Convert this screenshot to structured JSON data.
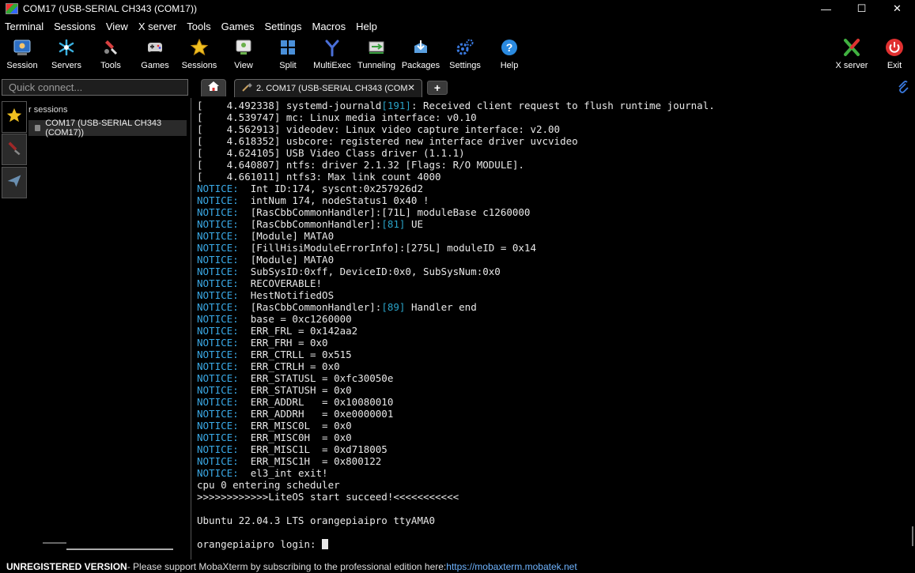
{
  "window": {
    "title": "COM17  (USB-SERIAL CH343 (COM17))",
    "controls": [
      "—",
      "☐",
      "✕"
    ]
  },
  "menu": [
    "Terminal",
    "Sessions",
    "View",
    "X server",
    "Tools",
    "Games",
    "Settings",
    "Macros",
    "Help"
  ],
  "toolbar": {
    "buttons": [
      {
        "label": "Session",
        "icon": "session-icon",
        "color": "#4a8fd8"
      },
      {
        "label": "Servers",
        "icon": "servers-icon",
        "color": "#3ab0e0"
      },
      {
        "label": "Tools",
        "icon": "tools-icon",
        "color": "#d84040"
      },
      {
        "label": "Games",
        "icon": "games-icon",
        "color": "#cfcfcf"
      },
      {
        "label": "Sessions",
        "icon": "star-icon",
        "color": "#f0c020"
      },
      {
        "label": "View",
        "icon": "view-icon",
        "color": "#6ab04c"
      },
      {
        "label": "Split",
        "icon": "split-icon",
        "color": "#4a8fd8"
      },
      {
        "label": "MultiExec",
        "icon": "multiexec-icon",
        "color": "#4a6fd8"
      },
      {
        "label": "Tunneling",
        "icon": "tunneling-icon",
        "color": "#3aa040"
      },
      {
        "label": "Packages",
        "icon": "packages-icon",
        "color": "#5aa0e0"
      },
      {
        "label": "Settings",
        "icon": "settings-icon",
        "color": "#3a7ae0"
      },
      {
        "label": "Help",
        "icon": "help-icon",
        "color": "#2a8ae0"
      }
    ],
    "right_buttons": [
      {
        "label": "X server",
        "icon": "xserver-icon",
        "color": "#40b040"
      },
      {
        "label": "Exit",
        "icon": "exit-icon",
        "color": "#e03030"
      }
    ]
  },
  "quick_connect": {
    "placeholder": "Quick connect..."
  },
  "sessions_panel": {
    "header": "r sessions",
    "item": "COM17  (USB-SERIAL CH343 (COM17))"
  },
  "tab": {
    "label": "2. COM17  (USB-SERIAL CH343 (COM"
  },
  "terminal": {
    "boot_lines": [
      {
        "ts": "[    4.492338] ",
        "pre": "systemd-journald",
        "num": "[191]",
        "post": ": Received client request to flush runtime journal."
      },
      {
        "ts": "[    4.539747] ",
        "pre": "mc: Linux media interface: v0.10",
        "num": "",
        "post": ""
      },
      {
        "ts": "[    4.562913] ",
        "pre": "videodev: Linux video capture interface: v2.00",
        "num": "",
        "post": ""
      },
      {
        "ts": "[    4.618352] ",
        "pre": "usbcore: registered new interface driver uvcvideo",
        "num": "",
        "post": ""
      },
      {
        "ts": "[    4.624105] ",
        "pre": "USB Video Class driver (1.1.1)",
        "num": "",
        "post": ""
      },
      {
        "ts": "[    4.640807] ",
        "pre": "ntfs: driver 2.1.32 [Flags: R/O MODULE].",
        "num": "",
        "post": ""
      },
      {
        "ts": "[    4.661011] ",
        "pre": "ntfs3: Max link count 4000",
        "num": "",
        "post": ""
      }
    ],
    "notice_label": "NOTICE:",
    "notices": [
      {
        "pre": "  Int ID:174, syscnt:0x257926d2",
        "num": "",
        "post": ""
      },
      {
        "pre": "  intNum 174, nodeStatus1 0x40 !",
        "num": "",
        "post": ""
      },
      {
        "pre": "  [RasCbbCommonHandler]:[71L] moduleBase c1260000",
        "num": "",
        "post": ""
      },
      {
        "pre": "  [RasCbbCommonHandler]:",
        "num": "[81]",
        "post": " UE"
      },
      {
        "pre": "  [Module] MATA0",
        "num": "",
        "post": ""
      },
      {
        "pre": "  [FillHisiModuleErrorInfo]:[275L] moduleID = 0x14",
        "num": "",
        "post": ""
      },
      {
        "pre": "  [Module] MATA0",
        "num": "",
        "post": ""
      },
      {
        "pre": "  SubSysID:0xff, DeviceID:0x0, SubSysNum:0x0",
        "num": "",
        "post": ""
      },
      {
        "pre": "  RECOVERABLE!",
        "num": "",
        "post": ""
      },
      {
        "pre": "  HestNotifiedOS",
        "num": "",
        "post": ""
      },
      {
        "pre": "  [RasCbbCommonHandler]:",
        "num": "[89]",
        "post": " Handler end"
      },
      {
        "pre": "  base = 0xc1260000",
        "num": "",
        "post": ""
      },
      {
        "pre": "  ERR_FRL = 0x142aa2",
        "num": "",
        "post": ""
      },
      {
        "pre": "  ERR_FRH = 0x0",
        "num": "",
        "post": ""
      },
      {
        "pre": "  ERR_CTRLL = 0x515",
        "num": "",
        "post": ""
      },
      {
        "pre": "  ERR_CTRLH = 0x0",
        "num": "",
        "post": ""
      },
      {
        "pre": "  ERR_STATUSL = 0xfc30050e",
        "num": "",
        "post": ""
      },
      {
        "pre": "  ERR_STATUSH = 0x0",
        "num": "",
        "post": ""
      },
      {
        "pre": "  ERR_ADDRL   = 0x10080010",
        "num": "",
        "post": ""
      },
      {
        "pre": "  ERR_ADDRH   = 0xe0000001",
        "num": "",
        "post": ""
      },
      {
        "pre": "  ERR_MISC0L  = 0x0",
        "num": "",
        "post": ""
      },
      {
        "pre": "  ERR_MISC0H  = 0x0",
        "num": "",
        "post": ""
      },
      {
        "pre": "  ERR_MISC1L  = 0xd718005",
        "num": "",
        "post": ""
      },
      {
        "pre": "  ERR_MISC1H  = 0x800122",
        "num": "",
        "post": ""
      },
      {
        "pre": "  el3_int exit!",
        "num": "",
        "post": ""
      }
    ],
    "tail_lines": [
      "cpu 0 entering scheduler",
      ">>>>>>>>>>>>LiteOS start succeed!<<<<<<<<<<<",
      "",
      "Ubuntu 22.04.3 LTS orangepiaipro ttyAMA0",
      ""
    ],
    "prompt": "orangepiaipro login: "
  },
  "status": {
    "unregistered": "UNREGISTERED VERSION",
    "message": "  -  Please support MobaXterm by subscribing to the professional edition here:  ",
    "link": "https://mobaxterm.mobatek.net"
  }
}
